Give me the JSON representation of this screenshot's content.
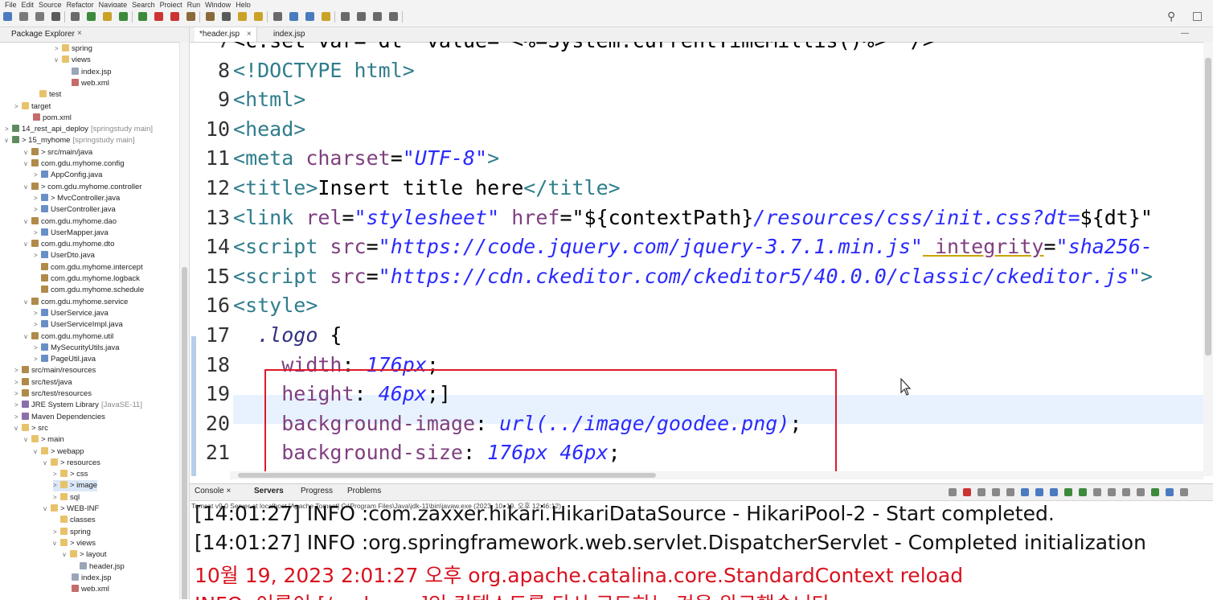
{
  "menu": [
    "File",
    "Edit",
    "Source",
    "Refactor",
    "Navigate",
    "Search",
    "Project",
    "Run",
    "Window",
    "Help"
  ],
  "explorer": {
    "title": "Package Explorer",
    "items": [
      {
        "label": "spring",
        "dec": "",
        "icon": "folder"
      },
      {
        "label": "views",
        "dec": "",
        "icon": "folder"
      },
      {
        "label": "index.jsp",
        "dec": "",
        "icon": "jsp"
      },
      {
        "label": "web.xml",
        "dec": "",
        "icon": "xml"
      },
      {
        "label": "test",
        "dec": "",
        "icon": "folder"
      },
      {
        "label": "target",
        "dec": "",
        "icon": "folder"
      },
      {
        "label": "pom.xml",
        "dec": "",
        "icon": "xml"
      },
      {
        "label": "14_rest_api_deploy",
        "dec": "[springstudy main]",
        "icon": "proj"
      },
      {
        "label": "> 15_myhome",
        "dec": "[springstudy main]",
        "icon": "proj"
      },
      {
        "label": "> src/main/java",
        "dec": "",
        "icon": "pkg"
      },
      {
        "label": "com.gdu.myhome.config",
        "dec": "",
        "icon": "pkg"
      },
      {
        "label": "AppConfig.java",
        "dec": "",
        "icon": "java"
      },
      {
        "label": "> com.gdu.myhome.controller",
        "dec": "",
        "icon": "pkg"
      },
      {
        "label": "> MvcController.java",
        "dec": "",
        "icon": "java"
      },
      {
        "label": "UserController.java",
        "dec": "",
        "icon": "java"
      },
      {
        "label": "com.gdu.myhome.dao",
        "dec": "",
        "icon": "pkg"
      },
      {
        "label": "UserMapper.java",
        "dec": "",
        "icon": "java"
      },
      {
        "label": "com.gdu.myhome.dto",
        "dec": "",
        "icon": "pkg"
      },
      {
        "label": "UserDto.java",
        "dec": "",
        "icon": "java"
      },
      {
        "label": "com.gdu.myhome.intercept",
        "dec": "",
        "icon": "pkg"
      },
      {
        "label": "com.gdu.myhome.logback",
        "dec": "",
        "icon": "pkg"
      },
      {
        "label": "com.gdu.myhome.schedule",
        "dec": "",
        "icon": "pkg"
      },
      {
        "label": "com.gdu.myhome.service",
        "dec": "",
        "icon": "pkg"
      },
      {
        "label": "UserService.java",
        "dec": "",
        "icon": "java"
      },
      {
        "label": "UserServiceImpl.java",
        "dec": "",
        "icon": "java"
      },
      {
        "label": "com.gdu.myhome.util",
        "dec": "",
        "icon": "pkg"
      },
      {
        "label": "MySecurityUtils.java",
        "dec": "",
        "icon": "java"
      },
      {
        "label": "PageUtil.java",
        "dec": "",
        "icon": "java"
      },
      {
        "label": "src/main/resources",
        "dec": "",
        "icon": "pkg"
      },
      {
        "label": "src/test/java",
        "dec": "",
        "icon": "pkg"
      },
      {
        "label": "src/test/resources",
        "dec": "",
        "icon": "pkg"
      },
      {
        "label": "JRE System Library",
        "dec": "[JavaSE-11]",
        "icon": "lib"
      },
      {
        "label": "Maven Dependencies",
        "dec": "",
        "icon": "lib"
      },
      {
        "label": "> src",
        "dec": "",
        "icon": "folder"
      },
      {
        "label": "> main",
        "dec": "",
        "icon": "folder"
      },
      {
        "label": "> webapp",
        "dec": "",
        "icon": "folder"
      },
      {
        "label": "> resources",
        "dec": "",
        "icon": "folder"
      },
      {
        "label": "> css",
        "dec": "",
        "icon": "folder"
      },
      {
        "label": "> image",
        "dec": "",
        "icon": "folder"
      },
      {
        "label": "sql",
        "dec": "",
        "icon": "folder"
      },
      {
        "label": "> WEB-INF",
        "dec": "",
        "icon": "folder"
      },
      {
        "label": "classes",
        "dec": "",
        "icon": "folder"
      },
      {
        "label": "spring",
        "dec": "",
        "icon": "folder"
      },
      {
        "label": "> views",
        "dec": "",
        "icon": "folder"
      },
      {
        "label": "> layout",
        "dec": "",
        "icon": "folder"
      },
      {
        "label": "header.jsp",
        "dec": "",
        "icon": "jsp"
      },
      {
        "label": "index.jsp",
        "dec": "",
        "icon": "jsp"
      },
      {
        "label": "web.xml",
        "dec": "",
        "icon": "xml"
      }
    ]
  },
  "editor": {
    "tabs": [
      {
        "label": "*header.jsp",
        "active": true
      },
      {
        "label": "index.jsp",
        "active": false
      }
    ],
    "lines": [
      {
        "num": "7",
        "seg": [
          [
            "plain",
            "<c:set var=\"dt\" value=\"<%=System.currentTimeMillis()%>\" />"
          ]
        ]
      },
      {
        "num": "8",
        "seg": [
          [
            "t",
            "<!"
          ],
          [
            "tn",
            "DOCTYPE html"
          ],
          [
            "t",
            ">"
          ]
        ]
      },
      {
        "num": "9",
        "seg": [
          [
            "t",
            "<"
          ],
          [
            "tn",
            "html"
          ],
          [
            "t",
            ">"
          ]
        ]
      },
      {
        "num": "10",
        "seg": [
          [
            "t",
            "<"
          ],
          [
            "tn",
            "head"
          ],
          [
            "t",
            ">"
          ]
        ]
      },
      {
        "num": "11",
        "seg": [
          [
            "t",
            "<"
          ],
          [
            "tn",
            "meta "
          ],
          [
            "attr",
            "charset"
          ],
          [
            "plain",
            "="
          ],
          [
            "str",
            "\"UTF-8\""
          ],
          [
            "t",
            ">"
          ]
        ]
      },
      {
        "num": "12",
        "seg": [
          [
            "t",
            "<"
          ],
          [
            "tn",
            "title"
          ],
          [
            "t",
            ">"
          ],
          [
            "plain",
            "Insert title here"
          ],
          [
            "t",
            "</"
          ],
          [
            "tn",
            "title"
          ],
          [
            "t",
            ">"
          ]
        ]
      },
      {
        "num": "13",
        "seg": [
          [
            "t",
            "<"
          ],
          [
            "tn",
            "link "
          ],
          [
            "attr",
            "rel"
          ],
          [
            "plain",
            "="
          ],
          [
            "str",
            "\"stylesheet\""
          ],
          [
            "attr",
            " href"
          ],
          [
            "plain",
            "=\"${contextPath}"
          ],
          [
            "str",
            "/resources/css/init.css?dt="
          ],
          [
            "plain",
            "${dt}\""
          ]
        ]
      },
      {
        "num": "14",
        "seg": [
          [
            "t",
            "<"
          ],
          [
            "tn",
            "script "
          ],
          [
            "attr",
            "src"
          ],
          [
            "plain",
            "="
          ],
          [
            "str",
            "\"https://code.jquery.com/jquery-3.7.1.min.js\""
          ],
          [
            "attr",
            " integrity"
          ],
          [
            "plain",
            "="
          ],
          [
            "str",
            "\"sha256-"
          ]
        ]
      },
      {
        "num": "15",
        "seg": [
          [
            "t",
            "<"
          ],
          [
            "tn",
            "script "
          ],
          [
            "attr",
            "src"
          ],
          [
            "plain",
            "="
          ],
          [
            "str",
            "\"https://cdn.ckeditor.com/ckeditor5/40.0.0/classic/ckeditor.js\""
          ],
          [
            "t",
            ">"
          ]
        ]
      },
      {
        "num": "16",
        "seg": [
          [
            "t",
            "<"
          ],
          [
            "tn",
            "style"
          ],
          [
            "t",
            ">"
          ]
        ]
      },
      {
        "num": "17",
        "seg": [
          [
            "plain",
            "  "
          ],
          [
            "sel",
            ".logo"
          ],
          [
            "plain",
            " {"
          ]
        ]
      },
      {
        "num": "18",
        "seg": [
          [
            "plain",
            "    "
          ],
          [
            "prop",
            "width"
          ],
          [
            "plain",
            ": "
          ],
          [
            "val",
            "176px"
          ],
          [
            "plain",
            ";"
          ]
        ]
      },
      {
        "num": "19",
        "seg": [
          [
            "plain",
            "    "
          ],
          [
            "prop",
            "height"
          ],
          [
            "plain",
            ": "
          ],
          [
            "val",
            "46px"
          ],
          [
            "plain",
            ";]"
          ]
        ]
      },
      {
        "num": "20",
        "seg": [
          [
            "plain",
            "    "
          ],
          [
            "prop",
            "background-image"
          ],
          [
            "plain",
            ": "
          ],
          [
            "val",
            "url(../image/goodee.png)"
          ],
          [
            "plain",
            ";"
          ]
        ]
      },
      {
        "num": "21",
        "seg": [
          [
            "plain",
            "    "
          ],
          [
            "prop",
            "background-size"
          ],
          [
            "plain",
            ": "
          ],
          [
            "val",
            "176px 46px"
          ],
          [
            "plain",
            ";"
          ]
        ]
      }
    ]
  },
  "console": {
    "tabs": [
      {
        "label": "Console",
        "active": false
      },
      {
        "label": "Servers",
        "active": true
      },
      {
        "label": "Progress",
        "active": false
      },
      {
        "label": "Problems",
        "active": false
      }
    ],
    "status": "Tomcat v9.0 Server at localhost [Apache Tomcat] C:\\Program Files\\Java\\jdk-11\\bin\\javaw.exe  (2023. 10. 19. 오후 12:46:12)",
    "lines": [
      {
        "kind": "info",
        "text": "[14:01:27] INFO :com.zaxxer.hikari.HikariDataSource - HikariPool-2 - Start completed."
      },
      {
        "kind": "info",
        "text": "[14:01:27] INFO :org.springframework.web.servlet.DispatcherServlet - Completed initialization"
      },
      {
        "kind": "err",
        "text": "10월 19, 2023 2:01:27 오후 org.apache.catalina.core.StandardContext reload"
      },
      {
        "kind": "err",
        "text": "INFO: 이름이 [/myhome]인 컨텍스트를 다시 로드하는 것을 완료했습니다."
      }
    ]
  },
  "colors": {
    "highlight_box": "#e0192a",
    "current_line": "#e8f2fe",
    "console_error": "#d8121e"
  },
  "icons": [
    "search-icon",
    "perspective-icon",
    "minimize-icon",
    "maximize-icon",
    "close-icon",
    "mouse-cursor-icon"
  ]
}
